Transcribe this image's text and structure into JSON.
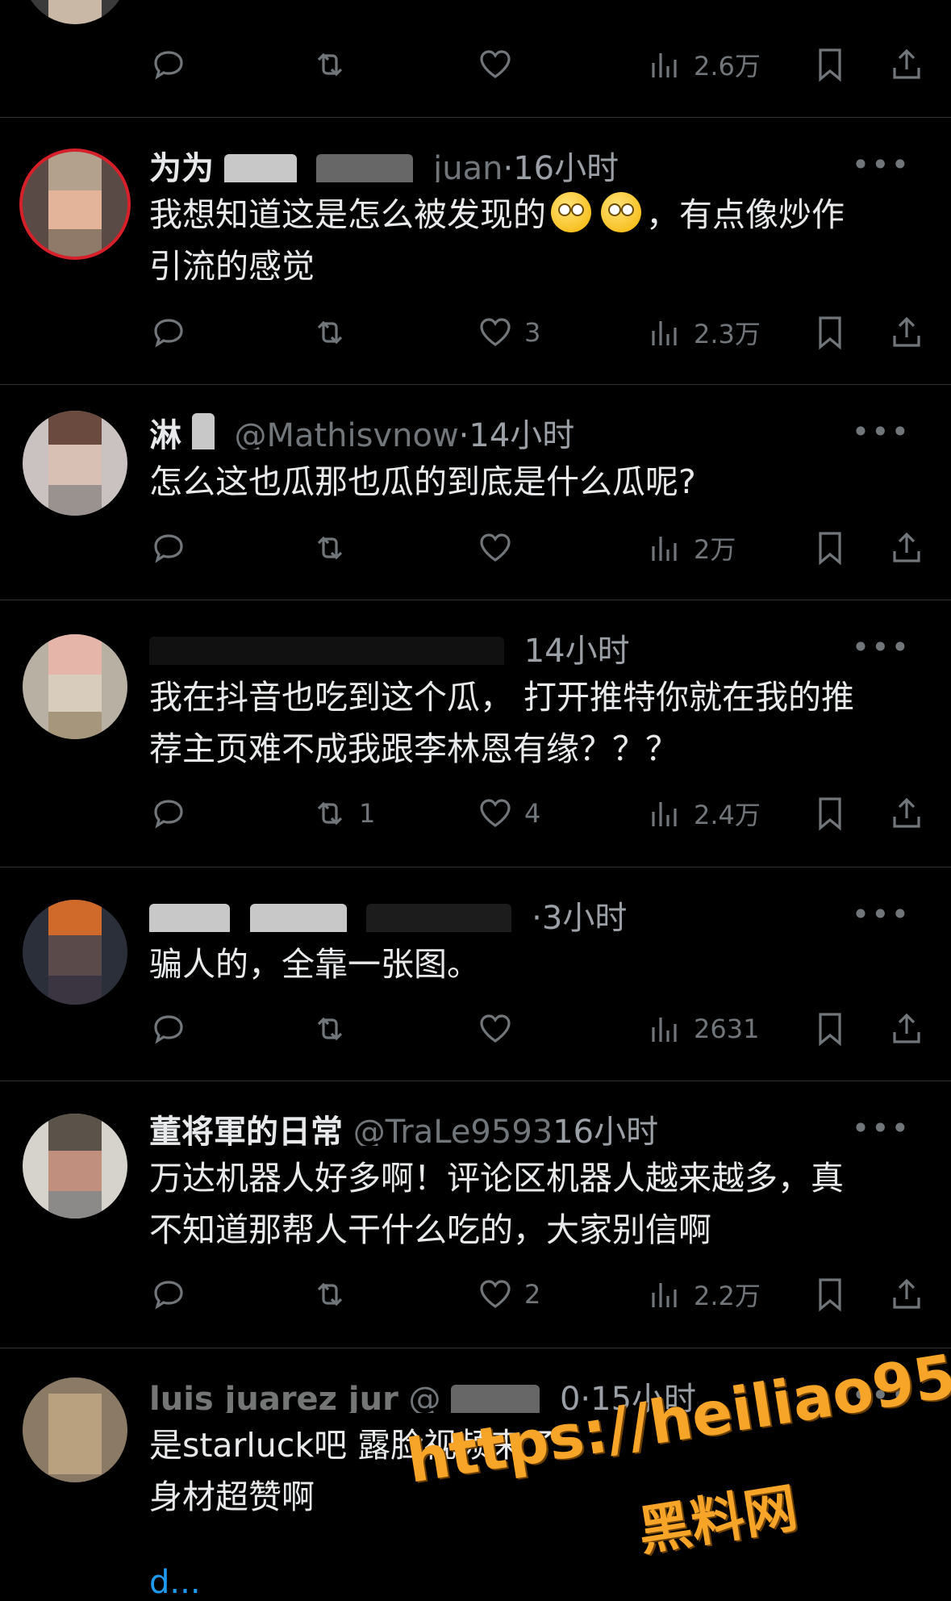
{
  "posts": [
    {
      "handle_visible": "",
      "time": "",
      "text": [],
      "stats": {
        "replies": "",
        "retweets": "",
        "likes": "",
        "views": "2.6万"
      }
    },
    {
      "handle_visible": "为为",
      "handle_tail": "juan",
      "time": "·16小时",
      "text": [
        "我想知道这是怎么被发现的",
        "，有点像炒作",
        "引流的感觉"
      ],
      "stats": {
        "replies": "",
        "retweets": "",
        "likes": "3",
        "views": "2.3万"
      }
    },
    {
      "handle_visible": "淋",
      "handle_tail": "@Mathisvnow",
      "time": "·14小时",
      "text": [
        "怎么这也瓜那也瓜的到底是什么瓜呢?"
      ],
      "stats": {
        "replies": "",
        "retweets": "",
        "likes": "",
        "views": "2万"
      }
    },
    {
      "handle_visible": "",
      "handle_tail": "",
      "time": "14小时",
      "text": [
        "我在抖音也吃到这个瓜， 打开推特你就在我的推",
        "荐主页难不成我跟李林恩有缘？？？"
      ],
      "stats": {
        "replies": "",
        "retweets": "1",
        "likes": "4",
        "views": "2.4万"
      }
    },
    {
      "handle_visible": "",
      "handle_tail": "",
      "time": "·3小时",
      "text": [
        "骗人的，全靠一张图。"
      ],
      "stats": {
        "replies": "",
        "retweets": "",
        "likes": "",
        "views": "2631"
      }
    },
    {
      "handle_visible": "董将軍的日常",
      "handle_tail": "@TraLe9593",
      "time": "16小时",
      "text": [
        "万达机器人好多啊！评论区机器人越来越多，真",
        "不知道那帮人干什么吃的，大家别信啊"
      ],
      "stats": {
        "replies": "",
        "retweets": "",
        "likes": "2",
        "views": "2.2万"
      }
    },
    {
      "handle_visible": "luis juarez jur",
      "handle_tail": "@",
      "time": "0·15小时",
      "text": [
        "是starluck吧 露脸视频来了",
        "身材超赞啊"
      ],
      "stats": {
        "replies": "",
        "retweets": "",
        "likes": "",
        "views": ""
      }
    }
  ],
  "more_label": "•••",
  "link_text": "d...",
  "watermark": {
    "url": "https://heiliao95.com",
    "name": "黑料网"
  },
  "colors": {
    "background": "#000000",
    "text": "#e7e9ea",
    "muted": "#71767b",
    "watermark": "#f7a528"
  }
}
